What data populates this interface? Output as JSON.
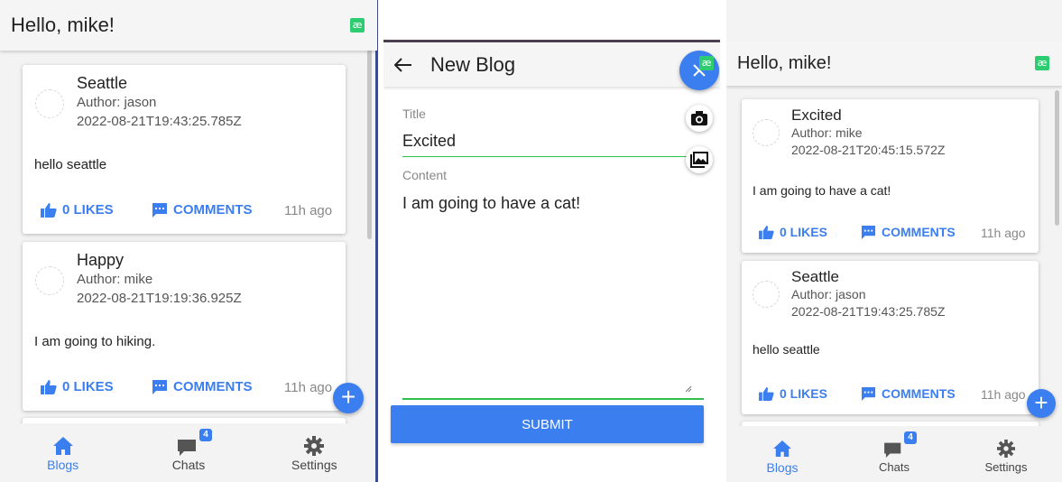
{
  "colors": {
    "accent": "#3b7ef0",
    "underline": "#2fc14a",
    "badge_green": "#2ecc71"
  },
  "feed1": {
    "header_title": "Hello, mike!",
    "posts": [
      {
        "title": "Seattle",
        "author": "Author: jason",
        "date": "2022-08-21T19:43:25.785Z",
        "body": "hello seattle",
        "likes": "0 LIKES",
        "comments": "COMMENTS",
        "ago": "11h ago"
      },
      {
        "title": "Happy",
        "author": "Author: mike",
        "date": "2022-08-21T19:19:36.925Z",
        "body": "I am going to hiking.",
        "likes": "0 LIKES",
        "comments": "COMMENTS",
        "ago": "11h ago"
      }
    ]
  },
  "editor": {
    "header_title": "New Blog",
    "title_label": "Title",
    "title_value": "Excited",
    "content_label": "Content",
    "content_value": "I am going to have a cat!",
    "submit_label": "SUBMIT"
  },
  "feed2": {
    "header_title": "Hello, mike!",
    "posts": [
      {
        "title": "Excited",
        "author": "Author: mike",
        "date": "2022-08-21T20:45:15.572Z",
        "body": "I am going to have a cat!",
        "likes": "0 LIKES",
        "comments": "COMMENTS",
        "ago": "11h ago"
      },
      {
        "title": "Seattle",
        "author": "Author: jason",
        "date": "2022-08-21T19:43:25.785Z",
        "body": "hello seattle",
        "likes": "0 LIKES",
        "comments": "COMMENTS",
        "ago": "11h ago"
      }
    ]
  },
  "tabs": {
    "blogs": "Blogs",
    "chats": "Chats",
    "settings": "Settings",
    "chats_badge": "4"
  },
  "icons": {
    "like": "thumb-up-icon",
    "comment": "comment-icon",
    "home": "home-icon",
    "chat": "chat-icon",
    "settings": "gear-icon",
    "add": "plus-icon",
    "camera": "camera-icon",
    "gallery": "image-icon",
    "back": "arrow-left-icon",
    "close": "close-icon"
  }
}
